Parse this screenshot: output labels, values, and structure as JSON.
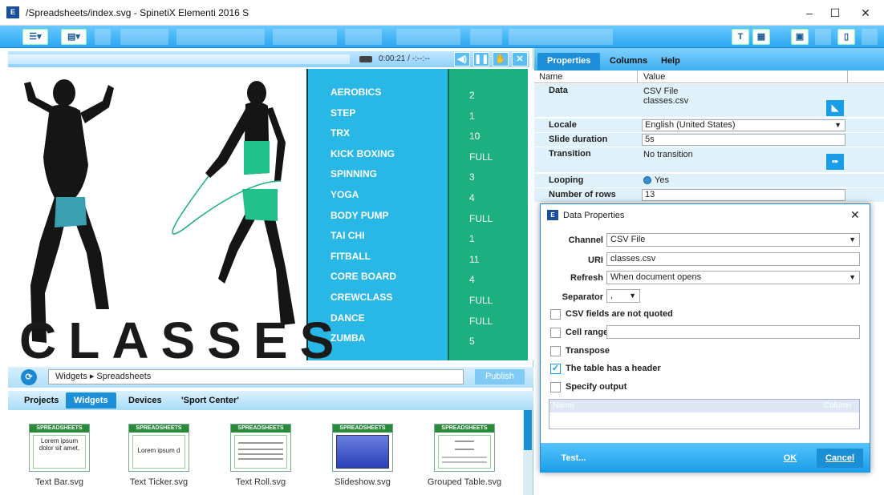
{
  "window": {
    "title": "/Spreadsheets/index.svg - SpinetiX Elementi 2016 S",
    "icon_text": "E",
    "minimize": "–",
    "maximize": "☐",
    "close": "✕"
  },
  "toolbar": {
    "text_label": "T",
    "colors": {
      "bar_top": "#6ac9ff",
      "bar_bottom": "#2aa6ef"
    }
  },
  "player": {
    "time": "0:00:21 / -:--:--",
    "btn_volume": "◀)",
    "btn_pause": "❚❚",
    "btn_hand": "✋",
    "btn_close": "✕"
  },
  "canvas": {
    "big_word": "CLASSES",
    "classes": [
      {
        "name": "AEROBICS",
        "value": "2"
      },
      {
        "name": "STEP",
        "value": "1"
      },
      {
        "name": "TRX",
        "value": "10"
      },
      {
        "name": "KICK BOXING",
        "value": "FULL"
      },
      {
        "name": "SPINNING",
        "value": "3"
      },
      {
        "name": "YOGA",
        "value": "4"
      },
      {
        "name": "BODY PUMP",
        "value": "FULL"
      },
      {
        "name": "TAI CHI",
        "value": "1"
      },
      {
        "name": "FITBALL",
        "value": "11"
      },
      {
        "name": "CORE BOARD",
        "value": "4"
      },
      {
        "name": "CREWCLASS",
        "value": "FULL"
      },
      {
        "name": "DANCE",
        "value": "FULL"
      },
      {
        "name": "ZUMBA",
        "value": "5"
      }
    ],
    "colors": {
      "blue": "#29b7e6",
      "green": "#1cb080"
    }
  },
  "widgets_panel": {
    "path_root": "Widgets",
    "path_sep": "▸",
    "path_leaf": "Spreadsheets",
    "publish": "Publish",
    "tabs": [
      "Projects",
      "Widgets",
      "Devices",
      "'Sport Center'"
    ],
    "active_tab": "Widgets",
    "items": [
      {
        "label": "Text Bar.svg",
        "header": "SPREADSHEETS",
        "preview": "Lorem ipsum dolor sit amet,"
      },
      {
        "label": "Text Ticker.svg",
        "header": "SPREADSHEETS",
        "preview": "Lorem ipsum d"
      },
      {
        "label": "Text Roll.svg",
        "header": "SPREADSHEETS",
        "preview": ""
      },
      {
        "label": "Slideshow.svg",
        "header": "SPREADSHEETS",
        "preview": ""
      },
      {
        "label": "Grouped Table.svg",
        "header": "SPREADSHEETS",
        "preview": ""
      }
    ]
  },
  "properties_panel": {
    "tabs": [
      "Properties",
      "Columns",
      "Help"
    ],
    "active_tab": "Properties",
    "col_name": "Name",
    "col_value": "Value",
    "rows": {
      "data_name": "Data",
      "data_value1": "CSV File",
      "data_value2": "classes.csv",
      "locale_name": "Locale",
      "locale_value": "English (United States)",
      "slide_name": "Slide duration",
      "slide_value": "5s",
      "transition_name": "Transition",
      "transition_value": "No transition",
      "looping_name": "Looping",
      "looping_value": "Yes",
      "rows_name": "Number of rows",
      "rows_value": "13"
    }
  },
  "dialog": {
    "title": "Data Properties",
    "channel_label": "Channel",
    "channel_value": "CSV File",
    "uri_label": "URI",
    "uri_value": "classes.csv",
    "refresh_label": "Refresh",
    "refresh_value": "When document opens",
    "separator_label": "Separator",
    "separator_value": ",",
    "csv_not_quoted": "CSV fields are not quoted",
    "cell_range": "Cell range",
    "transpose": "Transpose",
    "has_header": "The table has a header",
    "specify_output": "Specify output",
    "out_col_name": "Name",
    "out_col_column": "Column",
    "test_btn": "Test...",
    "ok_btn": "OK",
    "cancel_btn": "Cancel",
    "checks": {
      "csv_not_quoted": false,
      "cell_range": false,
      "transpose": false,
      "has_header": true,
      "specify_output": false
    }
  }
}
